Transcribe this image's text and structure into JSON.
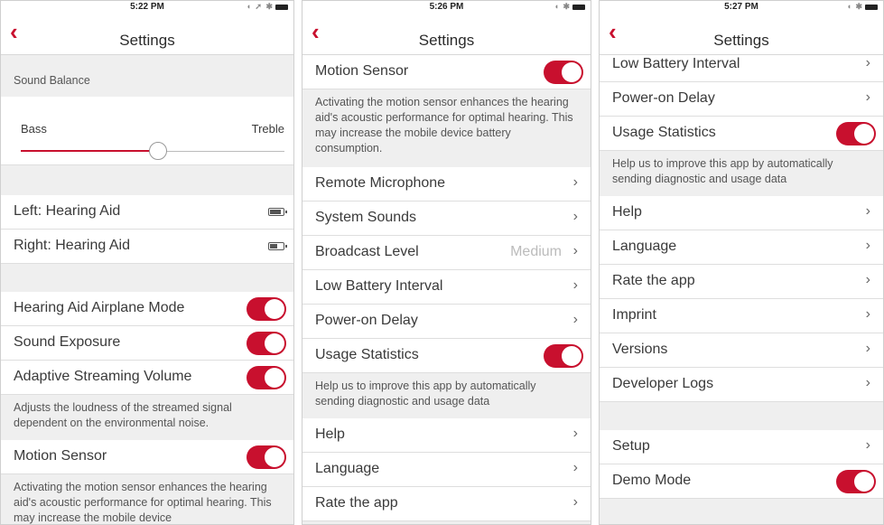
{
  "colors": {
    "accent": "#c8102e",
    "background": "#efefef"
  },
  "screen1": {
    "time": "5:22 PM",
    "title": "Settings",
    "sound_balance": "Sound Balance",
    "bass": "Bass",
    "treble": "Treble",
    "balance_level": 0.52,
    "left_aid": "Left: Hearing Aid",
    "right_aid": "Right: Hearing Aid",
    "airplane": "Hearing Aid Airplane Mode",
    "exposure": "Sound Exposure",
    "adaptive": "Adaptive Streaming Volume",
    "adaptive_desc": "Adjusts the loudness of the streamed signal dependent on the environmental noise.",
    "motion": "Motion Sensor",
    "motion_desc": "Activating the motion sensor enhances the hearing aid's acoustic performance for optimal hearing. This may increase the mobile device"
  },
  "screen2": {
    "time": "5:26 PM",
    "title": "Settings",
    "motion": "Motion Sensor",
    "motion_desc": "Activating the motion sensor enhances the hearing aid's acoustic performance for optimal hearing. This may increase the mobile device battery consumption.",
    "remote_mic": "Remote Microphone",
    "system_sounds": "System Sounds",
    "broadcast": "Broadcast Level",
    "broadcast_value": "Medium",
    "low_battery": "Low Battery Interval",
    "power_on": "Power-on Delay",
    "usage": "Usage Statistics",
    "usage_desc": "Help us to improve this app by automatically sending diagnostic and usage data",
    "help": "Help",
    "language": "Language",
    "rate": "Rate the app"
  },
  "screen3": {
    "time": "5:27 PM",
    "title": "Settings",
    "low_battery": "Low Battery Interval",
    "power_on": "Power-on Delay",
    "usage": "Usage Statistics",
    "usage_desc": "Help us to improve this app by automatically sending diagnostic and usage data",
    "help": "Help",
    "language": "Language",
    "rate": "Rate the app",
    "imprint": "Imprint",
    "versions": "Versions",
    "dev_logs": "Developer Logs",
    "setup": "Setup",
    "demo": "Demo Mode"
  },
  "icons": {
    "back": "‹",
    "chevron": "›"
  }
}
